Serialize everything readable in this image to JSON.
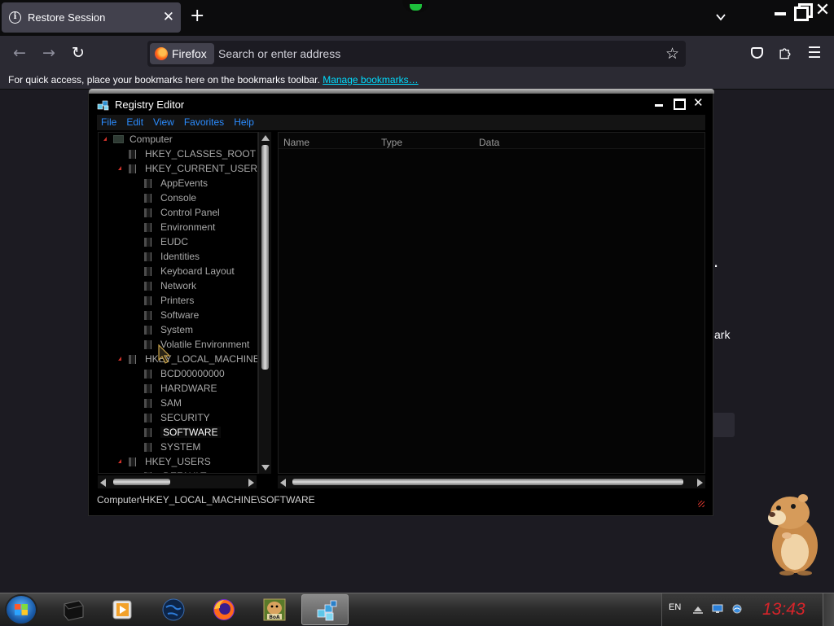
{
  "browser": {
    "tab": {
      "title": "Restore Session"
    },
    "urlbar": {
      "chip_label": "Firefox",
      "placeholder": "Search or enter address"
    },
    "bookmarks_bar": {
      "text": "For quick access, place your bookmarks here on the bookmarks toolbar.",
      "link": "Manage bookmarks…"
    }
  },
  "background_page": {
    "fragment_1": ".",
    "fragment_2": "ark"
  },
  "regedit": {
    "title": "Registry Editor",
    "menu": [
      "File",
      "Edit",
      "View",
      "Favorites",
      "Help"
    ],
    "tree": [
      {
        "label": "Computer",
        "level": 0,
        "expanded": true
      },
      {
        "label": "HKEY_CLASSES_ROOT",
        "level": 1,
        "expanded": false
      },
      {
        "label": "HKEY_CURRENT_USER",
        "level": 1,
        "expanded": true
      },
      {
        "label": "AppEvents",
        "level": 2
      },
      {
        "label": "Console",
        "level": 2
      },
      {
        "label": "Control Panel",
        "level": 2
      },
      {
        "label": "Environment",
        "level": 2
      },
      {
        "label": "EUDC",
        "level": 2
      },
      {
        "label": "Identities",
        "level": 2
      },
      {
        "label": "Keyboard Layout",
        "level": 2
      },
      {
        "label": "Network",
        "level": 2
      },
      {
        "label": "Printers",
        "level": 2
      },
      {
        "label": "Software",
        "level": 2
      },
      {
        "label": "System",
        "level": 2
      },
      {
        "label": "Volatile Environment",
        "level": 2
      },
      {
        "label": "HKEY_LOCAL_MACHINE",
        "level": 1,
        "expanded": true
      },
      {
        "label": "BCD00000000",
        "level": 2
      },
      {
        "label": "HARDWARE",
        "level": 2
      },
      {
        "label": "SAM",
        "level": 2
      },
      {
        "label": "SECURITY",
        "level": 2
      },
      {
        "label": "SOFTWARE",
        "level": 2,
        "selected": true
      },
      {
        "label": "SYSTEM",
        "level": 2
      },
      {
        "label": "HKEY_USERS",
        "level": 1,
        "expanded": true
      },
      {
        "label": ".DEFAULT",
        "level": 2
      }
    ],
    "columns": {
      "name": "Name",
      "type": "Type",
      "data": "Data"
    },
    "status_path": "Computer\\HKEY_LOCAL_MACHINE\\SOFTWARE"
  },
  "taskbar": {
    "apps": [
      {
        "name": "terminal-app-button",
        "icon": "terminal-icon"
      },
      {
        "name": "media-player-app-button",
        "icon": "media-player-icon"
      },
      {
        "name": "globe-app-button",
        "icon": "globe-icon"
      },
      {
        "name": "firefox-app-button",
        "icon": "firefox-icon"
      },
      {
        "name": "boa-app-button",
        "icon": "hamster-boa-icon",
        "text": "BoA"
      },
      {
        "name": "regedit-app-button",
        "icon": "registry-cubes-icon",
        "active": true
      }
    ],
    "tray": {
      "lang": "EN",
      "clock": "13:43"
    }
  },
  "colors": {
    "clock": "#d8242a",
    "menu_text": "#2b8cff",
    "link": "#00ddff",
    "tree_expander": "#d2322a"
  }
}
